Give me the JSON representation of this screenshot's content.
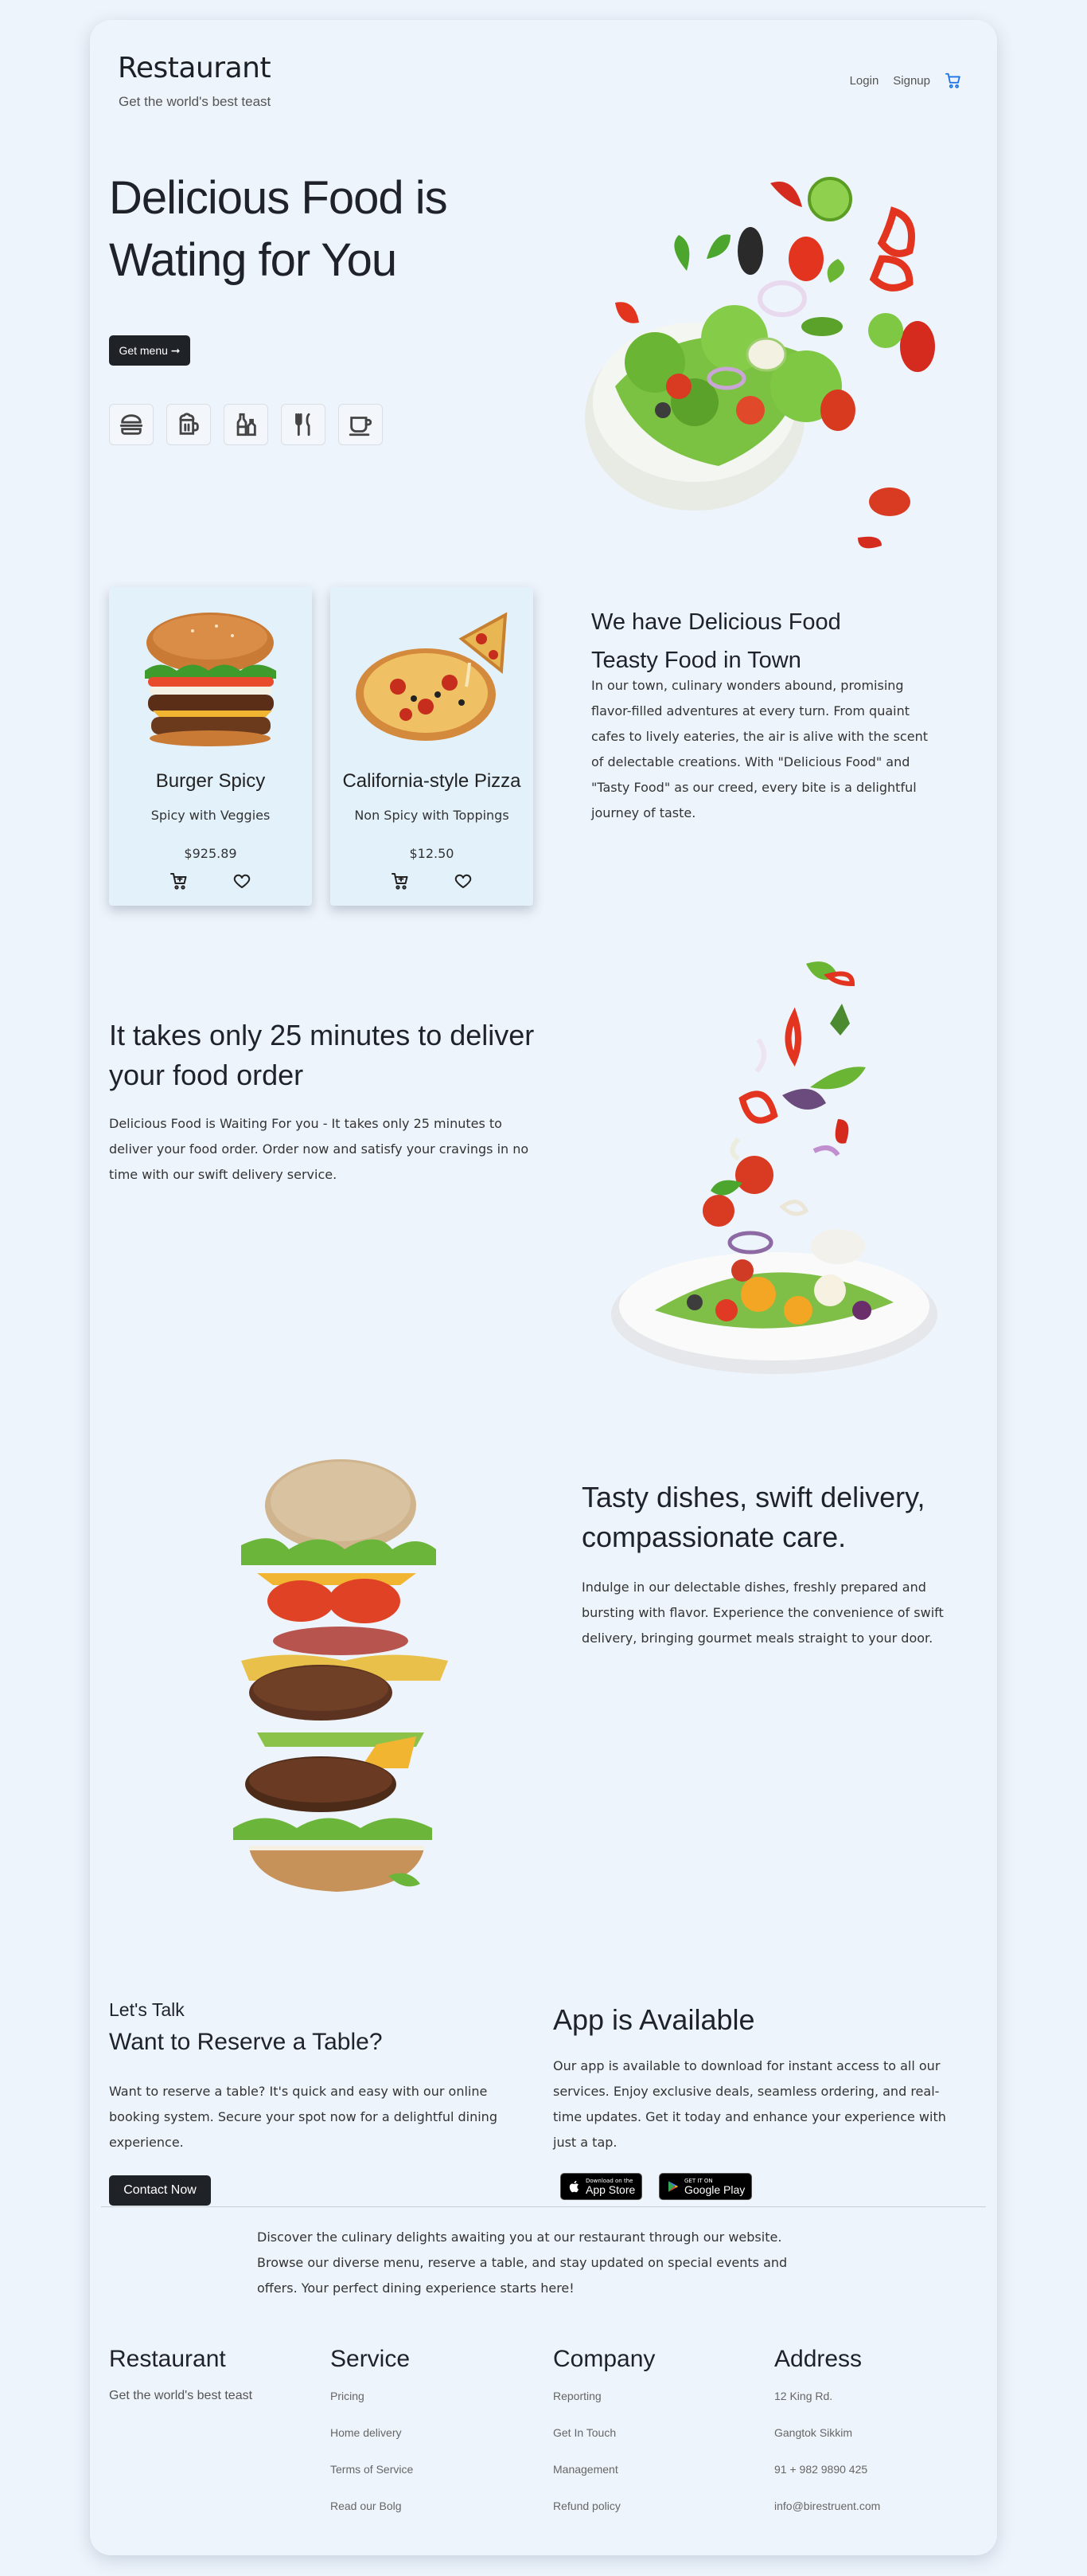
{
  "header": {
    "brand": "Restaurant",
    "tagline": "Get the world's best teast",
    "nav": {
      "login": "Login",
      "signup": "Signup"
    },
    "accent": "#1a73e8"
  },
  "hero": {
    "title_line1": "Delicious Food is",
    "title_line2": "Wating for You",
    "cta": "Get menu ➞",
    "icons": [
      "burger-icon",
      "beer-icon",
      "bottles-icon",
      "fork-knife-icon",
      "coffee-cup-icon"
    ]
  },
  "products": [
    {
      "name": "Burger Spicy",
      "desc": "Spicy with Veggies",
      "price": "$925.89"
    },
    {
      "name": "California-style Pizza",
      "desc": "Non Spicy with Toppings",
      "price": "$12.50"
    }
  ],
  "about": {
    "title1": "We have Delicious Food",
    "title2": "Teasty Food in Town",
    "text": "In our town, culinary wonders abound, promising flavor-filled adventures at every turn. From quaint cafes to lively eateries, the air is alive with the scent of delectable creations. With \"Delicious Food\" and \"Tasty Food\" as our creed, every bite is a delightful journey of taste."
  },
  "delivery": {
    "title": "It takes only 25 minutes to deliver your food order",
    "text": "Delicious Food is Waiting For you - It takes only 25 minutes to deliver your food order. Order now and satisfy your cravings in no time with our swift delivery service."
  },
  "care": {
    "title": "Tasty dishes, swift delivery, compassionate care.",
    "text": "Indulge in our delectable dishes, freshly prepared and bursting with flavor. Experience the convenience of swift delivery, bringing gourmet meals straight to your door."
  },
  "reserve": {
    "kicker": "Let's Talk",
    "title": "Want to Reserve a Table?",
    "text": "Want to reserve a table? It's quick and easy with our online booking system. Secure your spot now for a delightful dining experience.",
    "cta": "Contact Now"
  },
  "app": {
    "title": "App is Available",
    "text": "Our app is available to download for instant access to all our services. Enjoy exclusive deals, seamless ordering, and real-time updates. Get it today and enhance your experience with just a tap.",
    "appstore_small": "Download on the",
    "appstore_big": "App Store",
    "play_small": "GET IT ON",
    "play_big": "Google Play"
  },
  "footer": {
    "intro": "Discover the culinary delights awaiting you at our restaurant through our website. Browse our diverse menu, reserve a table, and stay updated on special events and offers. Your perfect dining experience starts here!",
    "brand": "Restaurant",
    "tagline": "Get the world's best teast",
    "service": {
      "title": "Service",
      "links": [
        "Pricing",
        "Home delivery",
        "Terms of Service",
        "Read our Bolg"
      ]
    },
    "company": {
      "title": "Company",
      "links": [
        "Reporting",
        "Get In Touch",
        "Management",
        "Refund policy"
      ]
    },
    "address": {
      "title": "Address",
      "lines": [
        "12 King Rd.",
        "Gangtok Sikkim",
        "91 + 982 9890 425",
        "info@birestruent.com"
      ]
    }
  }
}
